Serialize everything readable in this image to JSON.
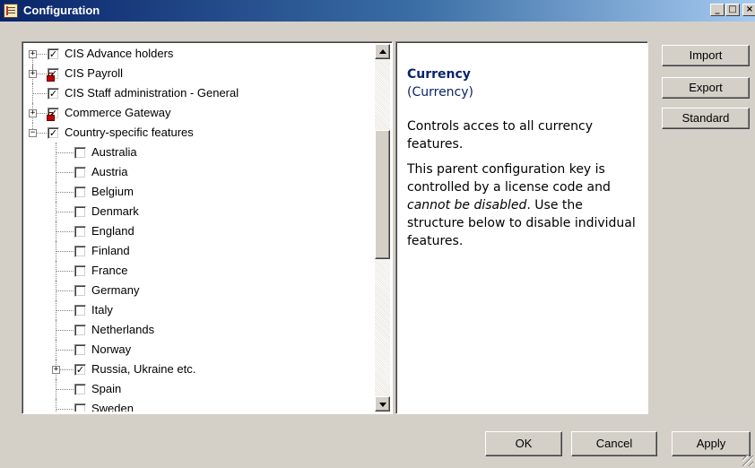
{
  "window": {
    "title": "Configuration",
    "minimize_label": "_",
    "maximize_label": "□",
    "close_label": "×"
  },
  "tree": {
    "items": [
      {
        "label": "CIS Advance holders",
        "checked": true,
        "locked": false,
        "expandable": true,
        "expanded": false,
        "level": 0
      },
      {
        "label": "CIS Payroll",
        "checked": true,
        "locked": true,
        "expandable": true,
        "expanded": false,
        "level": 0
      },
      {
        "label": "CIS Staff administration - General",
        "checked": true,
        "locked": false,
        "expandable": false,
        "level": 0
      },
      {
        "label": "Commerce Gateway",
        "checked": true,
        "locked": true,
        "expandable": true,
        "expanded": false,
        "level": 0
      },
      {
        "label": "Country-specific features",
        "checked": true,
        "locked": false,
        "expandable": true,
        "expanded": true,
        "level": 0
      },
      {
        "label": "Australia",
        "checked": false,
        "expandable": false,
        "level": 1
      },
      {
        "label": "Austria",
        "checked": false,
        "expandable": false,
        "level": 1
      },
      {
        "label": "Belgium",
        "checked": false,
        "expandable": false,
        "level": 1
      },
      {
        "label": "Denmark",
        "checked": false,
        "expandable": false,
        "level": 1
      },
      {
        "label": "England",
        "checked": false,
        "expandable": false,
        "level": 1
      },
      {
        "label": "Finland",
        "checked": false,
        "expandable": false,
        "level": 1
      },
      {
        "label": "France",
        "checked": false,
        "expandable": false,
        "level": 1
      },
      {
        "label": "Germany",
        "checked": false,
        "expandable": false,
        "level": 1
      },
      {
        "label": "Italy",
        "checked": false,
        "expandable": false,
        "level": 1
      },
      {
        "label": "Netherlands",
        "checked": false,
        "expandable": false,
        "level": 1
      },
      {
        "label": "Norway",
        "checked": false,
        "expandable": false,
        "level": 1
      },
      {
        "label": "Russia, Ukraine etc.",
        "checked": true,
        "expandable": true,
        "expanded": false,
        "level": 1
      },
      {
        "label": "Spain",
        "checked": false,
        "expandable": false,
        "level": 1
      },
      {
        "label": "Sweden",
        "checked": false,
        "expandable": false,
        "level": 1
      }
    ]
  },
  "description": {
    "title": "Currency",
    "subtitle": "(Currency)",
    "para1": "Controls acces to all currency features.",
    "para2_before": "This parent configuration key is controlled by a license code and ",
    "para2_emphasis": "cannot be disabled",
    "para2_after": ". Use the structure below to disable individual features."
  },
  "side_buttons": {
    "import_label": "Import",
    "export_label": "Export",
    "standard_label": "Standard"
  },
  "footer": {
    "ok_label": "OK",
    "cancel_label": "Cancel",
    "apply_label": "Apply"
  },
  "colors": {
    "title_gradient_start": "#0a246a",
    "title_gradient_end": "#a6caf0",
    "dialog_face": "#d4d0c8",
    "heading": "#0a246a",
    "lock": "#c00000"
  }
}
